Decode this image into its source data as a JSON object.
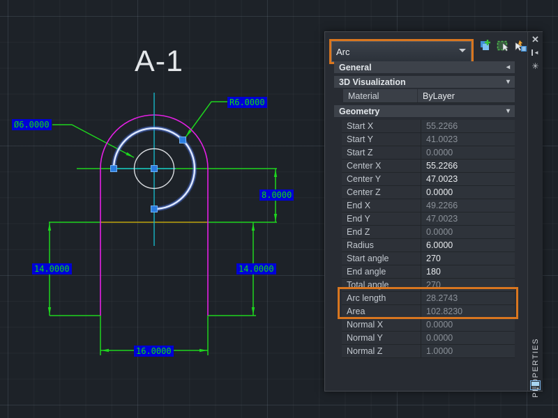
{
  "drawing": {
    "title": "A-1",
    "labels": {
      "diameter": "Ø6.0000",
      "radius": "R6.0000",
      "offset_top": "8.0000",
      "height_left": "14.0000",
      "height_right": "14.0000",
      "width_bottom": "16.0000"
    },
    "colors": {
      "dimension_green": "#1ed41e",
      "label_bg_blue": "#0000d6",
      "label_text_green": "#12dc12",
      "outline_magenta": "#e520e5",
      "centerline_cyan": "#16b6c8",
      "hidden_yellow": "#bfa40e",
      "selection_blue": "#4d79ff",
      "grip_blue": "#2b7de0",
      "accent_orange": "#d9761f"
    }
  },
  "panel": {
    "selector_value": "Arc",
    "strip_title": "PROPERTIES",
    "icons": {
      "close": "✕",
      "autohide": "◄",
      "settings": "✳",
      "collapsed_arrow": "◂",
      "expanded_arrow": "▾"
    },
    "sections": [
      {
        "label": "General",
        "collapsed": true,
        "rows": []
      },
      {
        "label": "3D Visualization",
        "collapsed": false,
        "rows": [
          {
            "label": "Material",
            "value": "ByLayer",
            "editable": true
          }
        ]
      },
      {
        "label": "Geometry",
        "collapsed": false,
        "rows": [
          {
            "label": "Start X",
            "value": "55.2266",
            "editable": false
          },
          {
            "label": "Start Y",
            "value": "41.0023",
            "editable": false
          },
          {
            "label": "Start Z",
            "value": "0.0000",
            "editable": false
          },
          {
            "label": "Center X",
            "value": "55.2266",
            "editable": true
          },
          {
            "label": "Center Y",
            "value": "47.0023",
            "editable": true
          },
          {
            "label": "Center Z",
            "value": "0.0000",
            "editable": true
          },
          {
            "label": "End X",
            "value": "49.2266",
            "editable": false
          },
          {
            "label": "End Y",
            "value": "47.0023",
            "editable": false
          },
          {
            "label": "End Z",
            "value": "0.0000",
            "editable": false
          },
          {
            "label": "Radius",
            "value": "6.0000",
            "editable": true
          },
          {
            "label": "Start angle",
            "value": "270",
            "editable": true
          },
          {
            "label": "End angle",
            "value": "180",
            "editable": true
          },
          {
            "label": "Total angle",
            "value": "270",
            "editable": false
          },
          {
            "label": "Arc length",
            "value": "28.2743",
            "editable": false,
            "highlighted": true
          },
          {
            "label": "Area",
            "value": "102.8230",
            "editable": false,
            "highlighted": true
          },
          {
            "label": "Normal X",
            "value": "0.0000",
            "editable": false
          },
          {
            "label": "Normal Y",
            "value": "0.0000",
            "editable": false
          },
          {
            "label": "Normal Z",
            "value": "1.0000",
            "editable": false
          }
        ]
      }
    ]
  }
}
